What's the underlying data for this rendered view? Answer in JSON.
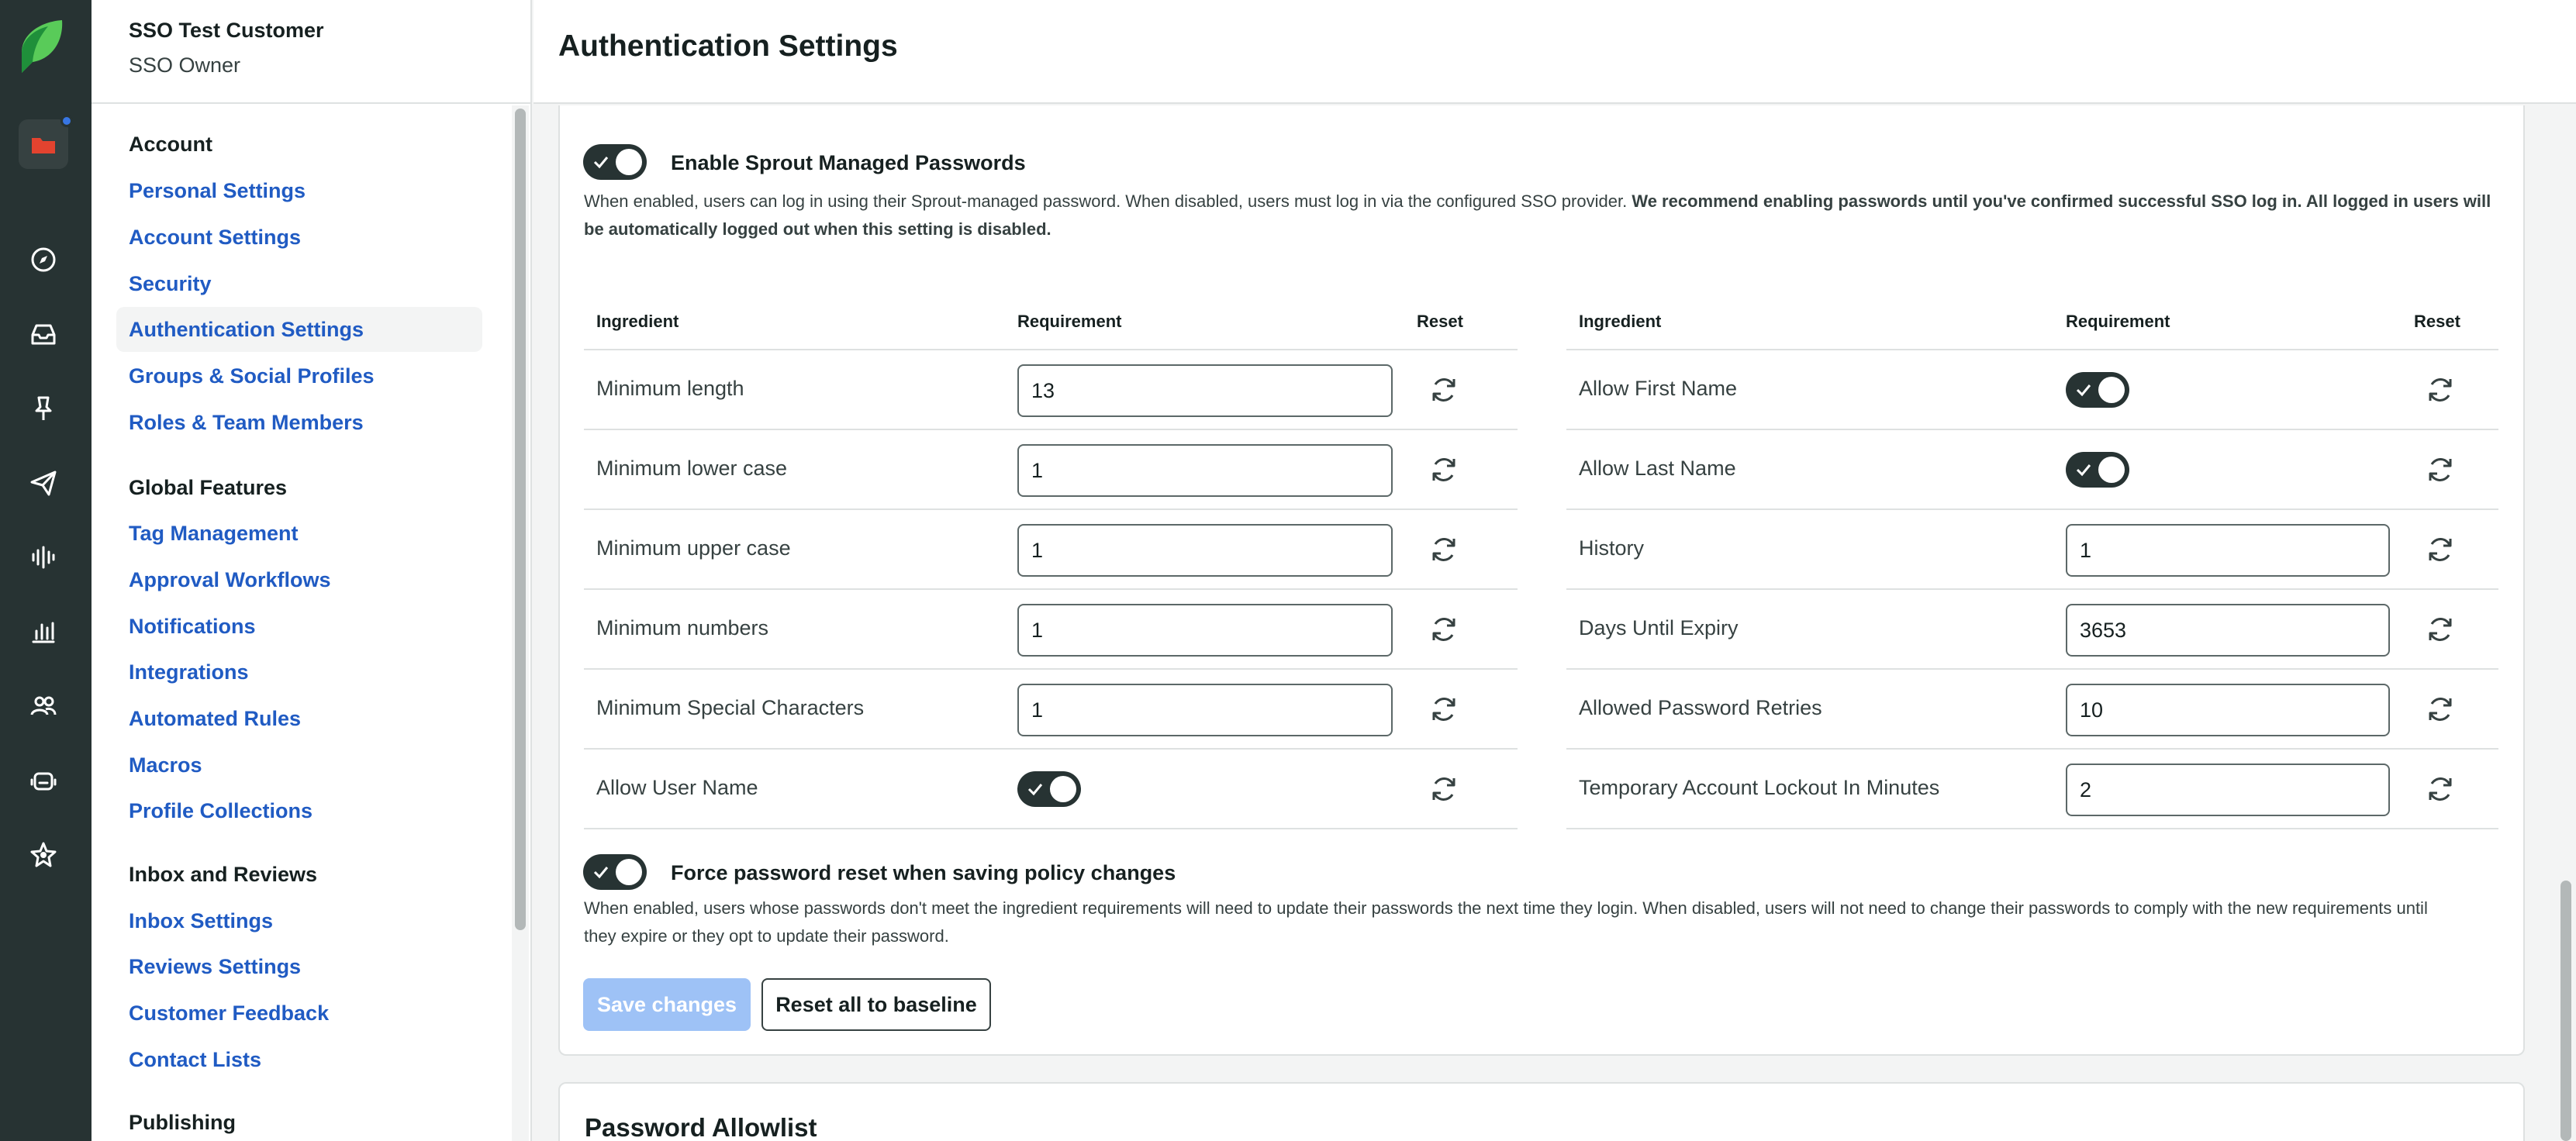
{
  "customer": {
    "name": "SSO Test Customer",
    "role": "SSO Owner"
  },
  "header": {
    "title": "Authentication Settings"
  },
  "sidebar": {
    "sections": [
      {
        "title": "Account",
        "items": [
          "Personal Settings",
          "Account Settings",
          "Security",
          "Authentication Settings",
          "Groups & Social Profiles",
          "Roles & Team Members"
        ]
      },
      {
        "title": "Global Features",
        "items": [
          "Tag Management",
          "Approval Workflows",
          "Notifications",
          "Integrations",
          "Automated Rules",
          "Macros",
          "Profile Collections"
        ]
      },
      {
        "title": "Inbox and Reviews",
        "items": [
          "Inbox Settings",
          "Reviews Settings",
          "Customer Feedback",
          "Contact Lists"
        ]
      },
      {
        "title": "Publishing",
        "items": []
      }
    ],
    "active_item": "Authentication Settings"
  },
  "sprout_passwords": {
    "label": "Enable Sprout Managed Passwords",
    "enabled": true,
    "description": "When enabled, users can log in using their Sprout-managed password. When disabled, users must log in via the configured SSO provider.",
    "description_bold": "We recommend enabling passwords until you've confirmed successful SSO log in. All logged in users will be automatically logged out when this setting is disabled."
  },
  "table": {
    "headers": {
      "ingredient": "Ingredient",
      "requirement": "Requirement",
      "reset": "Reset"
    },
    "left_rows": [
      {
        "ingredient": "Minimum length",
        "type": "input",
        "value": "13"
      },
      {
        "ingredient": "Minimum lower case",
        "type": "input",
        "value": "1"
      },
      {
        "ingredient": "Minimum upper case",
        "type": "input",
        "value": "1"
      },
      {
        "ingredient": "Minimum numbers",
        "type": "input",
        "value": "1"
      },
      {
        "ingredient": "Minimum Special Characters",
        "type": "input",
        "value": "1"
      },
      {
        "ingredient": "Allow User Name",
        "type": "toggle",
        "value": "on"
      }
    ],
    "right_rows": [
      {
        "ingredient": "Allow First Name",
        "type": "toggle",
        "value": "on"
      },
      {
        "ingredient": "Allow Last Name",
        "type": "toggle",
        "value": "on"
      },
      {
        "ingredient": "History",
        "type": "input",
        "value": "1"
      },
      {
        "ingredient": "Days Until Expiry",
        "type": "input",
        "value": "3653"
      },
      {
        "ingredient": "Allowed Password Retries",
        "type": "input",
        "value": "10"
      },
      {
        "ingredient": "Temporary Account Lockout In Minutes",
        "type": "input",
        "value": "2"
      }
    ]
  },
  "force_reset": {
    "label": "Force password reset when saving policy changes",
    "enabled": true,
    "description": "When enabled, users whose passwords don't meet the ingredient requirements will need to update their passwords the next time they login. When disabled, users will not need to change their passwords to comply with the new requirements until they expire or they opt to update their password."
  },
  "buttons": {
    "save": "Save changes",
    "reset_all": "Reset all to baseline"
  },
  "allowlist": {
    "title": "Password Allowlist"
  },
  "colors": {
    "nav_dark": "#273333",
    "link_blue": "#205bc3",
    "save_disabled": "#9ec2f6",
    "brand_green": "#59cb59"
  },
  "rail_icons": [
    "sprout-logo-icon",
    "folder-icon",
    "compass-icon",
    "inbox-icon",
    "pin-icon",
    "send-icon",
    "listening-icon",
    "reports-icon",
    "people-icon",
    "bot-icon",
    "star-icon"
  ]
}
